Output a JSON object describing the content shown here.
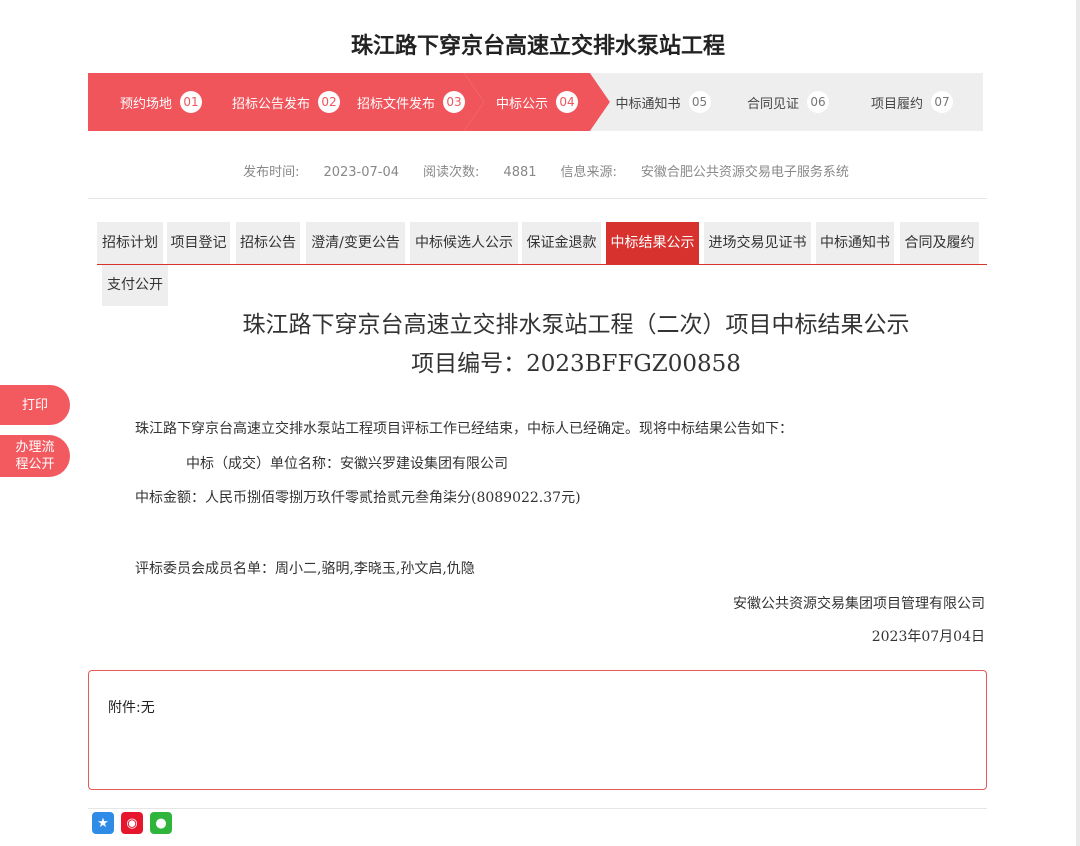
{
  "page": {
    "title": "珠江路下穿京台高速立交排水泵站工程"
  },
  "steps": [
    {
      "label": "预约场地",
      "num": "01",
      "state": "active"
    },
    {
      "label": "招标公告发布",
      "num": "02",
      "state": "active"
    },
    {
      "label": "招标文件发布",
      "num": "03",
      "state": "active"
    },
    {
      "label": "中标公示",
      "num": "04",
      "state": "active"
    },
    {
      "label": "中标通知书",
      "num": "05",
      "state": "inactive"
    },
    {
      "label": "合同见证",
      "num": "06",
      "state": "inactive"
    },
    {
      "label": "项目履约",
      "num": "07",
      "state": "inactive"
    }
  ],
  "meta": {
    "publish_label": "发布时间:",
    "publish_date": "2023-07-04",
    "views_label": "阅读次数:",
    "views": "4881",
    "source_label": "信息来源:",
    "source": "安徽合肥公共资源交易电子服务系统"
  },
  "tabs": [
    {
      "label": "招标计划"
    },
    {
      "label": "项目登记"
    },
    {
      "label": "招标公告"
    },
    {
      "label": "澄清/变更公告"
    },
    {
      "label": "中标候选人公示"
    },
    {
      "label": "保证金退款"
    },
    {
      "label": "中标结果公示",
      "active": true
    },
    {
      "label": "进场交易见证书"
    },
    {
      "label": "中标通知书"
    },
    {
      "label": "合同及履约"
    },
    {
      "label": "支付公开"
    }
  ],
  "doc": {
    "title": "珠江路下穿京台高速立交排水泵站工程（二次）项目中标结果公示",
    "project_no": "项目编号：2023BFFGZ00858",
    "intro": "珠江路下穿京台高速立交排水泵站工程项目评标工作已经结束，中标人已经确定。现将中标结果公告如下：",
    "winner": "中标（成交）单位名称：安徽兴罗建设集团有限公司",
    "amount": "中标金额：人民币捌佰零捌万玖仟零贰拾贰元叁角柒分(8089022.37元)",
    "committee": "评标委员会成员名单：周小二,骆明,李晓玉,孙文启,仇隐",
    "agency": "安徽公共资源交易集团项目管理有限公司",
    "date": "2023年07月04日"
  },
  "side": {
    "print": "打印",
    "process_line1": "办理流",
    "process_line2": "程公开"
  },
  "attachment": {
    "label": "附件:无"
  },
  "share": [
    {
      "icon": "qzone-icon",
      "color": "#2e8be6"
    },
    {
      "icon": "weibo-icon",
      "color": "#e6162d"
    },
    {
      "icon": "wechat-icon",
      "color": "#2fb53b"
    }
  ]
}
